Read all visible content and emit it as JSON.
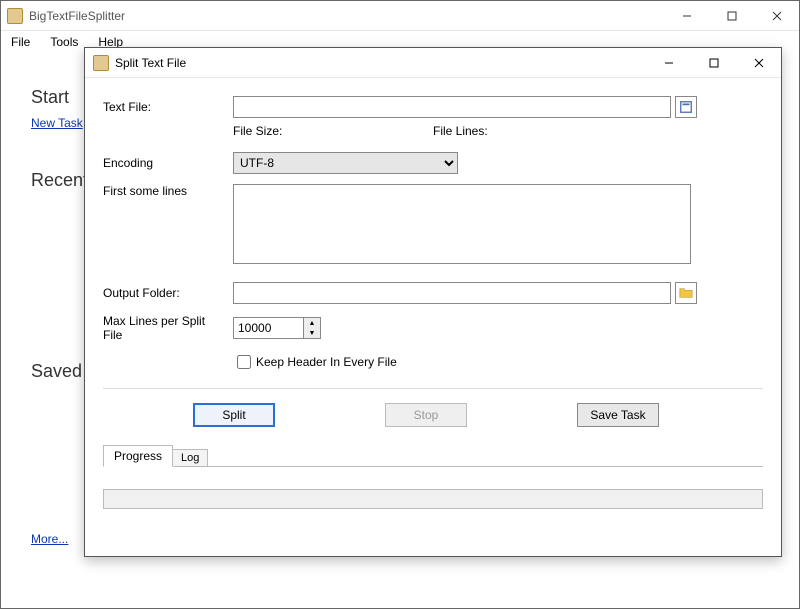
{
  "main_window": {
    "title": "BigTextFileSplitter",
    "menu": {
      "file": "File",
      "tools": "Tools",
      "help": "Help"
    },
    "sections": {
      "start": "Start",
      "new_task": "New Task",
      "recent": "Recent",
      "saved": "Saved",
      "more": "More..."
    }
  },
  "dialog": {
    "title": "Split Text File",
    "labels": {
      "text_file": "Text File:",
      "file_size": "File Size:",
      "file_lines": "File Lines:",
      "encoding": "Encoding",
      "first_lines": "First some lines",
      "output_folder": "Output Folder:",
      "max_lines": "Max Lines per Split File",
      "keep_header": "Keep Header In Every File"
    },
    "values": {
      "text_file": "",
      "encoding": "UTF-8",
      "first_lines": "",
      "output_folder": "",
      "max_lines": "10000",
      "keep_header_checked": false
    },
    "buttons": {
      "split": "Split",
      "stop": "Stop",
      "save_task": "Save Task"
    },
    "tabs": {
      "progress": "Progress",
      "log": "Log"
    }
  }
}
